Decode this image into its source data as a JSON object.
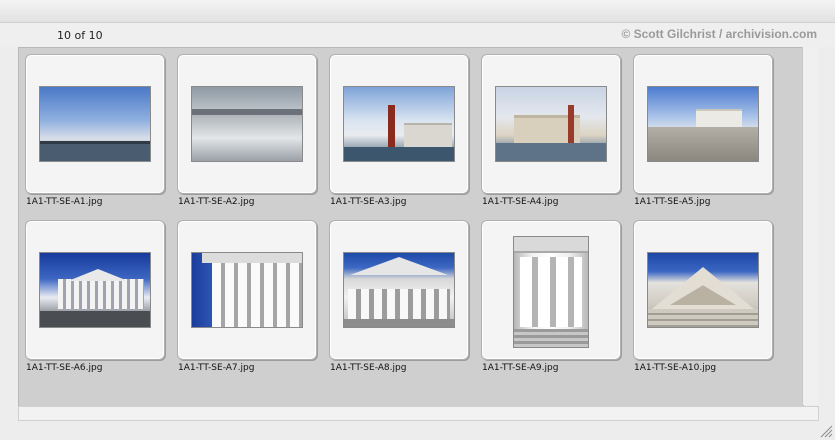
{
  "viewer": {
    "counter": "10 of 10",
    "copyright": "© Scott Gilchrist / archivision.com"
  },
  "items": [
    {
      "filename": "1A1-TT-SE-A1.jpg"
    },
    {
      "filename": "1A1-TT-SE-A2.jpg"
    },
    {
      "filename": "1A1-TT-SE-A3.jpg"
    },
    {
      "filename": "1A1-TT-SE-A4.jpg"
    },
    {
      "filename": "1A1-TT-SE-A5.jpg"
    },
    {
      "filename": "1A1-TT-SE-A6.jpg"
    },
    {
      "filename": "1A1-TT-SE-A7.jpg"
    },
    {
      "filename": "1A1-TT-SE-A8.jpg"
    },
    {
      "filename": "1A1-TT-SE-A9.jpg"
    },
    {
      "filename": "1A1-TT-SE-A10.jpg"
    }
  ]
}
